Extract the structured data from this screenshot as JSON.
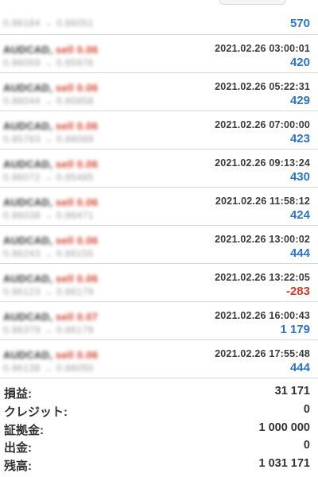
{
  "first_row": {
    "prices": "0.86184 → 0.86051",
    "profit": "570"
  },
  "trades": [
    {
      "symbol": "AUDCAD,",
      "side": "sell 0.06",
      "prices": "0.86059 → 0.85976",
      "time": "2021.02.26 03:00:01",
      "profit": "420",
      "negative": false
    },
    {
      "symbol": "AUDCAD,",
      "side": "sell 0.06",
      "prices": "0.86044 → 0.85858",
      "time": "2021.02.26 05:22:31",
      "profit": "429",
      "negative": false
    },
    {
      "symbol": "AUDCAD,",
      "side": "sell 0.06",
      "prices": "0.85783 → 0.86089",
      "time": "2021.02.26 07:00:00",
      "profit": "423",
      "negative": false
    },
    {
      "symbol": "AUDCAD,",
      "side": "sell 0.06",
      "prices": "0.86072 → 0.85485",
      "time": "2021.02.26 09:13:24",
      "profit": "430",
      "negative": false
    },
    {
      "symbol": "AUDCAD,",
      "side": "sell 0.06",
      "prices": "0.86038 → 0.86471",
      "time": "2021.02.26 11:58:12",
      "profit": "424",
      "negative": false
    },
    {
      "symbol": "AUDCAD,",
      "side": "sell 0.06",
      "prices": "0.86243 → 0.86155",
      "time": "2021.02.26 13:00:02",
      "profit": "444",
      "negative": false
    },
    {
      "symbol": "AUDCAD,",
      "side": "sell 0.06",
      "prices": "0.86123 → 0.86179",
      "time": "2021.02.26 13:22:05",
      "profit": "-283",
      "negative": true
    },
    {
      "symbol": "AUDCAD,",
      "side": "sell 0.07",
      "prices": "0.86379 → 0.86179",
      "time": "2021.02.26 16:00:43",
      "profit": "1 179",
      "negative": false
    },
    {
      "symbol": "AUDCAD,",
      "side": "sell 0.06",
      "prices": "0.86138 → 0.86050",
      "time": "2021.02.26 17:55:48",
      "profit": "444",
      "negative": false
    }
  ],
  "summary": [
    {
      "label": "損益:",
      "value": "31 171"
    },
    {
      "label": "クレジット:",
      "value": "0"
    },
    {
      "label": "証拠金:",
      "value": "1 000 000"
    },
    {
      "label": "出金:",
      "value": "0"
    },
    {
      "label": "残高:",
      "value": "1 031 171"
    }
  ],
  "colors": {
    "profit_positive": "#2c73c7",
    "profit_negative": "#d23a2a",
    "side": "#d23a2a"
  }
}
